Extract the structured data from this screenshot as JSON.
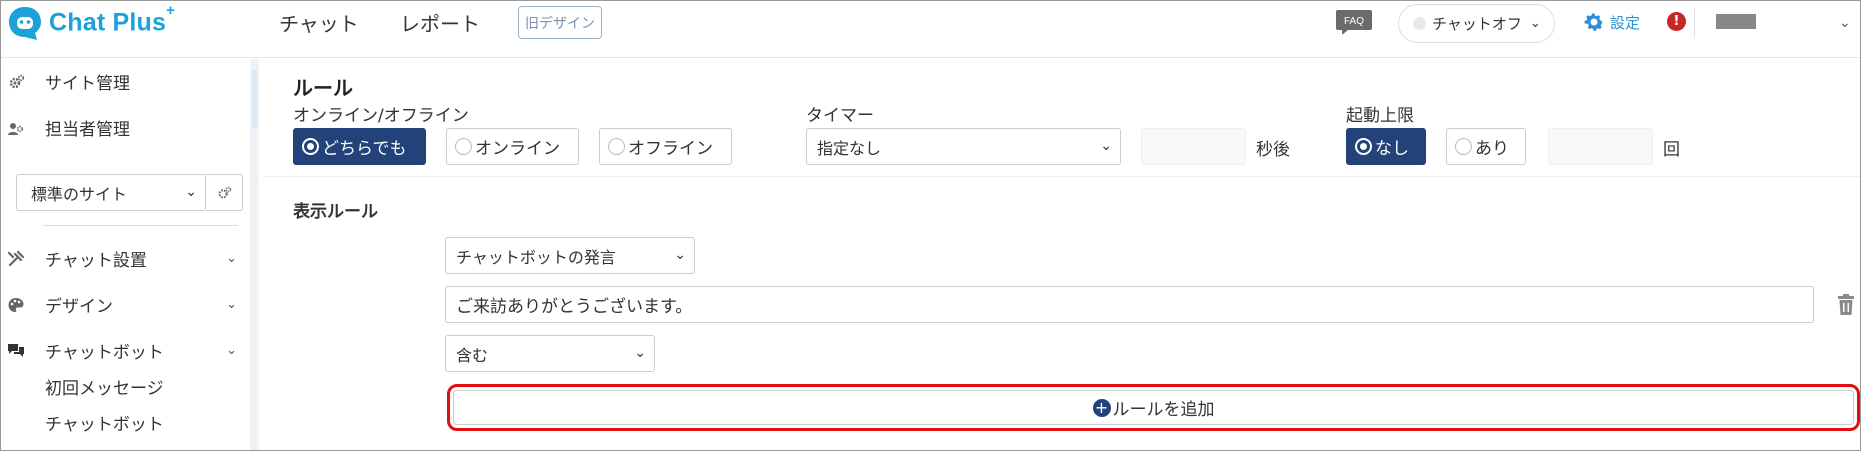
{
  "header": {
    "logo_text": "Chat Plus",
    "logo_sup": "+",
    "nav": [
      "チャット",
      "レポート"
    ],
    "old_design": "旧デザイン",
    "faq": "FAQ",
    "status": "チャットオフ",
    "settings": "設定",
    "alert": "!"
  },
  "sidebar": {
    "site_manage": "サイト管理",
    "staff_manage": "担当者管理",
    "site_select": "標準のサイト",
    "chat_settings": "チャット設置",
    "design": "デザイン",
    "chatbot": "チャットボット",
    "sub_items": [
      "初回メッセージ",
      "チャットボット"
    ]
  },
  "main": {
    "title": "ルール",
    "online_label": "オンライン/オフライン",
    "online_options": [
      "どちらでも",
      "オンライン",
      "オフライン"
    ],
    "timer_label": "タイマー",
    "timer_value": "指定なし",
    "timer_seconds": "",
    "seconds_unit": "秒後",
    "limit_label": "起動上限",
    "limit_options": [
      "なし",
      "あり"
    ],
    "limit_count": "",
    "count_unit": "回",
    "display_rule_title": "表示ルール",
    "rule_type": "チャットボットの発言",
    "rule_text": "ご来訪ありがとうございます。",
    "match_type": "含む",
    "add_rule": "ルールを追加"
  },
  "colors": {
    "brand": "#1aa2d9",
    "primary": "#24427a",
    "highlight": "#e01010",
    "alert": "#c62828"
  }
}
